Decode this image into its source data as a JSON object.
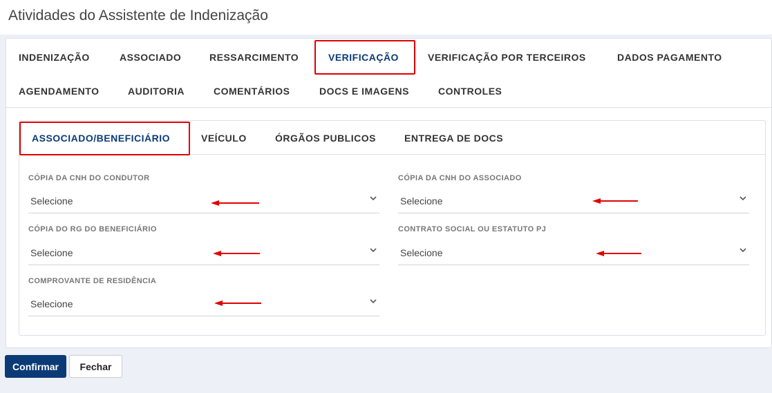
{
  "page": {
    "title": "Atividades do Assistente de Indenização"
  },
  "main_tabs": [
    {
      "label": "INDENIZAÇÃO"
    },
    {
      "label": "ASSOCIADO"
    },
    {
      "label": "RESSARCIMENTO"
    },
    {
      "label": "VERIFICAÇÃO",
      "active": true
    },
    {
      "label": "VERIFICAÇÃO POR TERCEIROS"
    },
    {
      "label": "DADOS PAGAMENTO"
    },
    {
      "label": "AGENDAMENTO"
    },
    {
      "label": "AUDITORIA"
    },
    {
      "label": "COMENTÁRIOS"
    },
    {
      "label": "DOCS E IMAGENS"
    },
    {
      "label": "CONTROLES"
    }
  ],
  "sub_tabs": [
    {
      "label": "ASSOCIADO/BENEFICIÁRIO",
      "active": true
    },
    {
      "label": "VEÍCULO"
    },
    {
      "label": "ÓRGÃOS PUBLICOS"
    },
    {
      "label": "ENTREGA DE DOCS"
    }
  ],
  "fields": [
    {
      "label": "CÓPIA DA CNH DO CONDUTOR",
      "value": "Selecione"
    },
    {
      "label": "CÓPIA DA CNH DO ASSOCIADO",
      "value": "Selecione"
    },
    {
      "label": "CÓPIA DO RG DO BENEFICIÁRIO",
      "value": "Selecione"
    },
    {
      "label": "CONTRATO SOCIAL OU ESTATUTO PJ",
      "value": "Selecione"
    },
    {
      "label": "COMPROVANTE DE RESIDÊNCIA",
      "value": "Selecione"
    }
  ],
  "buttons": {
    "confirm": "Confirmar",
    "close": "Fechar"
  },
  "colors": {
    "accent": "#0b3b77",
    "highlight": "#e00000",
    "annotation_arrow": "#e00000"
  },
  "icons": {
    "select_indicator": "chevron-down-icon",
    "annotation": "arrow-left-icon"
  }
}
